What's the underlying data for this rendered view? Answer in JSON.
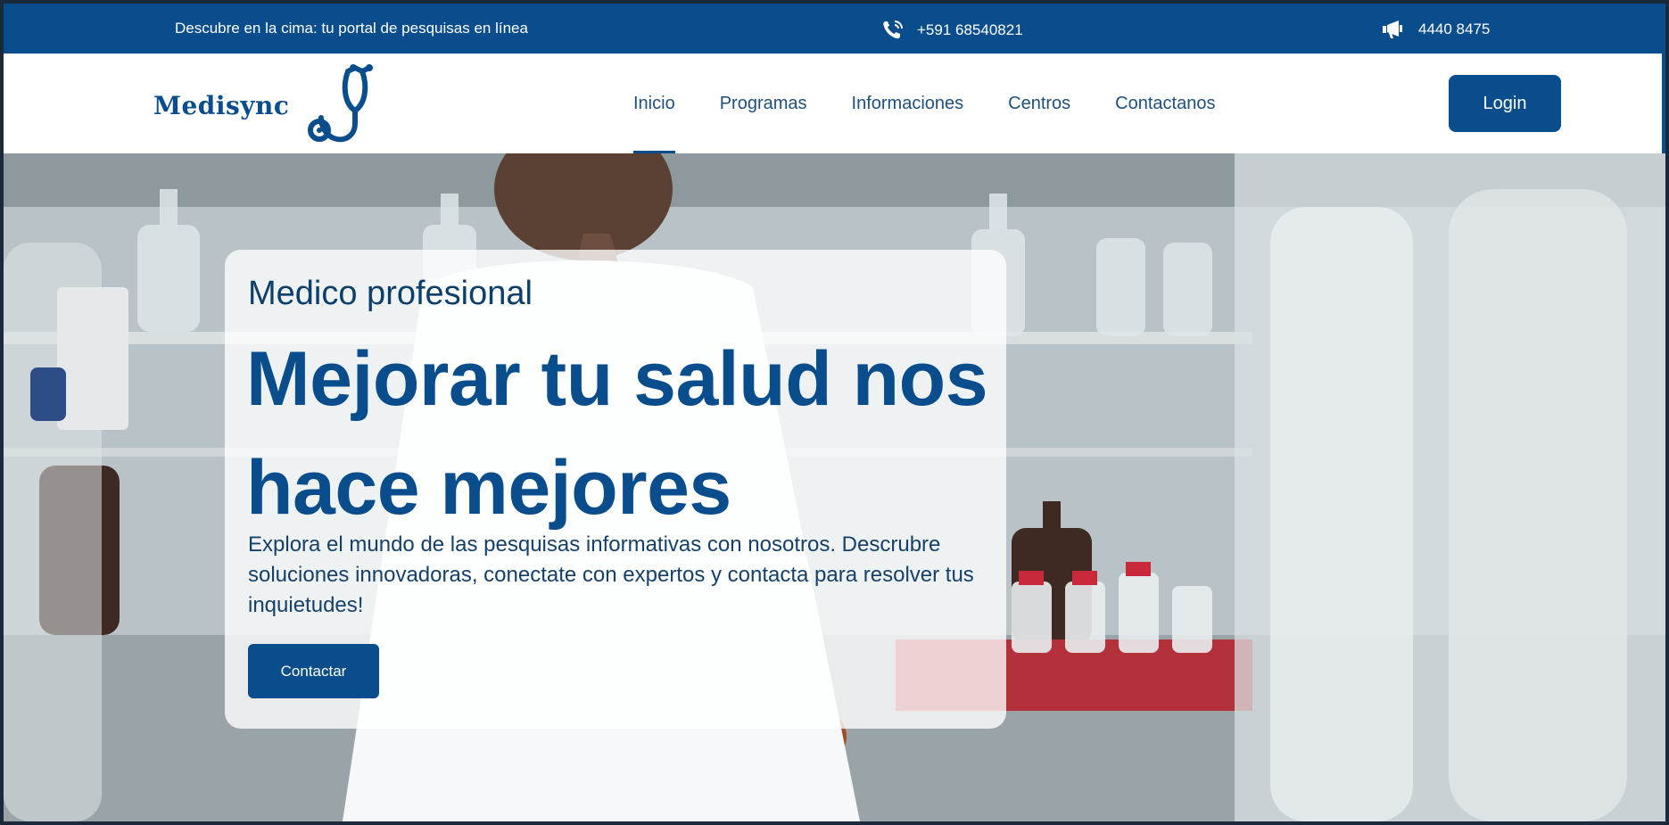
{
  "topbar": {
    "tagline": "Descubre en la cima: tu portal de pesquisas en línea",
    "phone": "+591 68540821",
    "phone_icon": "phone-call-icon",
    "fax": "4440 8475",
    "fax_icon": "megaphone-icon"
  },
  "header": {
    "logo_text": "Medisync",
    "logo_icon": "stethoscope-icon",
    "nav": [
      {
        "label": "Inicio",
        "active": true
      },
      {
        "label": "Programas"
      },
      {
        "label": "Informaciones"
      },
      {
        "label": "Centros"
      },
      {
        "label": "Contactanos"
      }
    ],
    "login_label": "Login"
  },
  "hero": {
    "eyebrow": "Medico profesional",
    "headline": "Mejorar tu salud nos hace mejores",
    "description": "Explora el mundo de las pesquisas informativas con nosotros. Descrubre soluciones innovadoras, conectate con expertos y contacta para resolver tus inquietudes!",
    "cta_label": "Contactar"
  },
  "colors": {
    "brand": "#0a4d8c",
    "nav_text": "#1e4f7d",
    "card_bg": "rgba(255,255,255,0.78)"
  }
}
